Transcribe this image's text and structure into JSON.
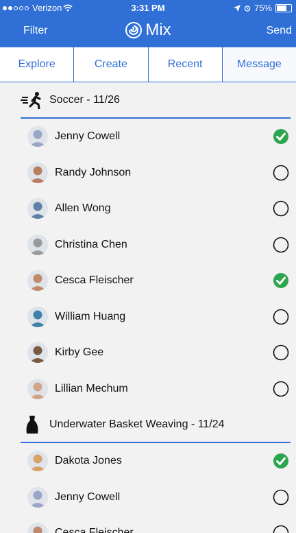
{
  "status_bar": {
    "carrier": "Verizon",
    "time": "3:31 PM",
    "battery": "75%",
    "battery_level": 0.75
  },
  "nav": {
    "left": "Filter",
    "title": "Mix",
    "right": "Send"
  },
  "tabs": [
    {
      "label": "Explore",
      "active": false
    },
    {
      "label": "Create",
      "active": false
    },
    {
      "label": "Recent",
      "active": false
    },
    {
      "label": "Message",
      "active": true
    }
  ],
  "groups": [
    {
      "title": "Soccer - 11/26",
      "icon": "runner-icon",
      "members": [
        {
          "name": "Jenny Cowell",
          "selected": true,
          "tone": "#9aa6c8"
        },
        {
          "name": "Randy Johnson",
          "selected": false,
          "tone": "#b77e5f"
        },
        {
          "name": "Allen Wong",
          "selected": false,
          "tone": "#5e7fa8"
        },
        {
          "name": "Christina Chen",
          "selected": false,
          "tone": "#9a9a9a"
        },
        {
          "name": "Cesca Fleischer",
          "selected": true,
          "tone": "#c0896a"
        },
        {
          "name": "William Huang",
          "selected": false,
          "tone": "#3f82a8"
        },
        {
          "name": "Kirby Gee",
          "selected": false,
          "tone": "#7a5a40"
        },
        {
          "name": "Lillian Mechum",
          "selected": false,
          "tone": "#d2a58a"
        }
      ]
    },
    {
      "title": "Underwater Basket Weaving - 11/24",
      "icon": "vase-icon",
      "members": [
        {
          "name": "Dakota Jones",
          "selected": true,
          "tone": "#d8a26b"
        },
        {
          "name": "Jenny Cowell",
          "selected": false,
          "tone": "#9aa6c8"
        },
        {
          "name": "Cesca Fleischer",
          "selected": false,
          "tone": "#c0896a"
        }
      ]
    }
  ],
  "colors": {
    "brand": "#2f6fd6",
    "check": "#2da44e"
  }
}
